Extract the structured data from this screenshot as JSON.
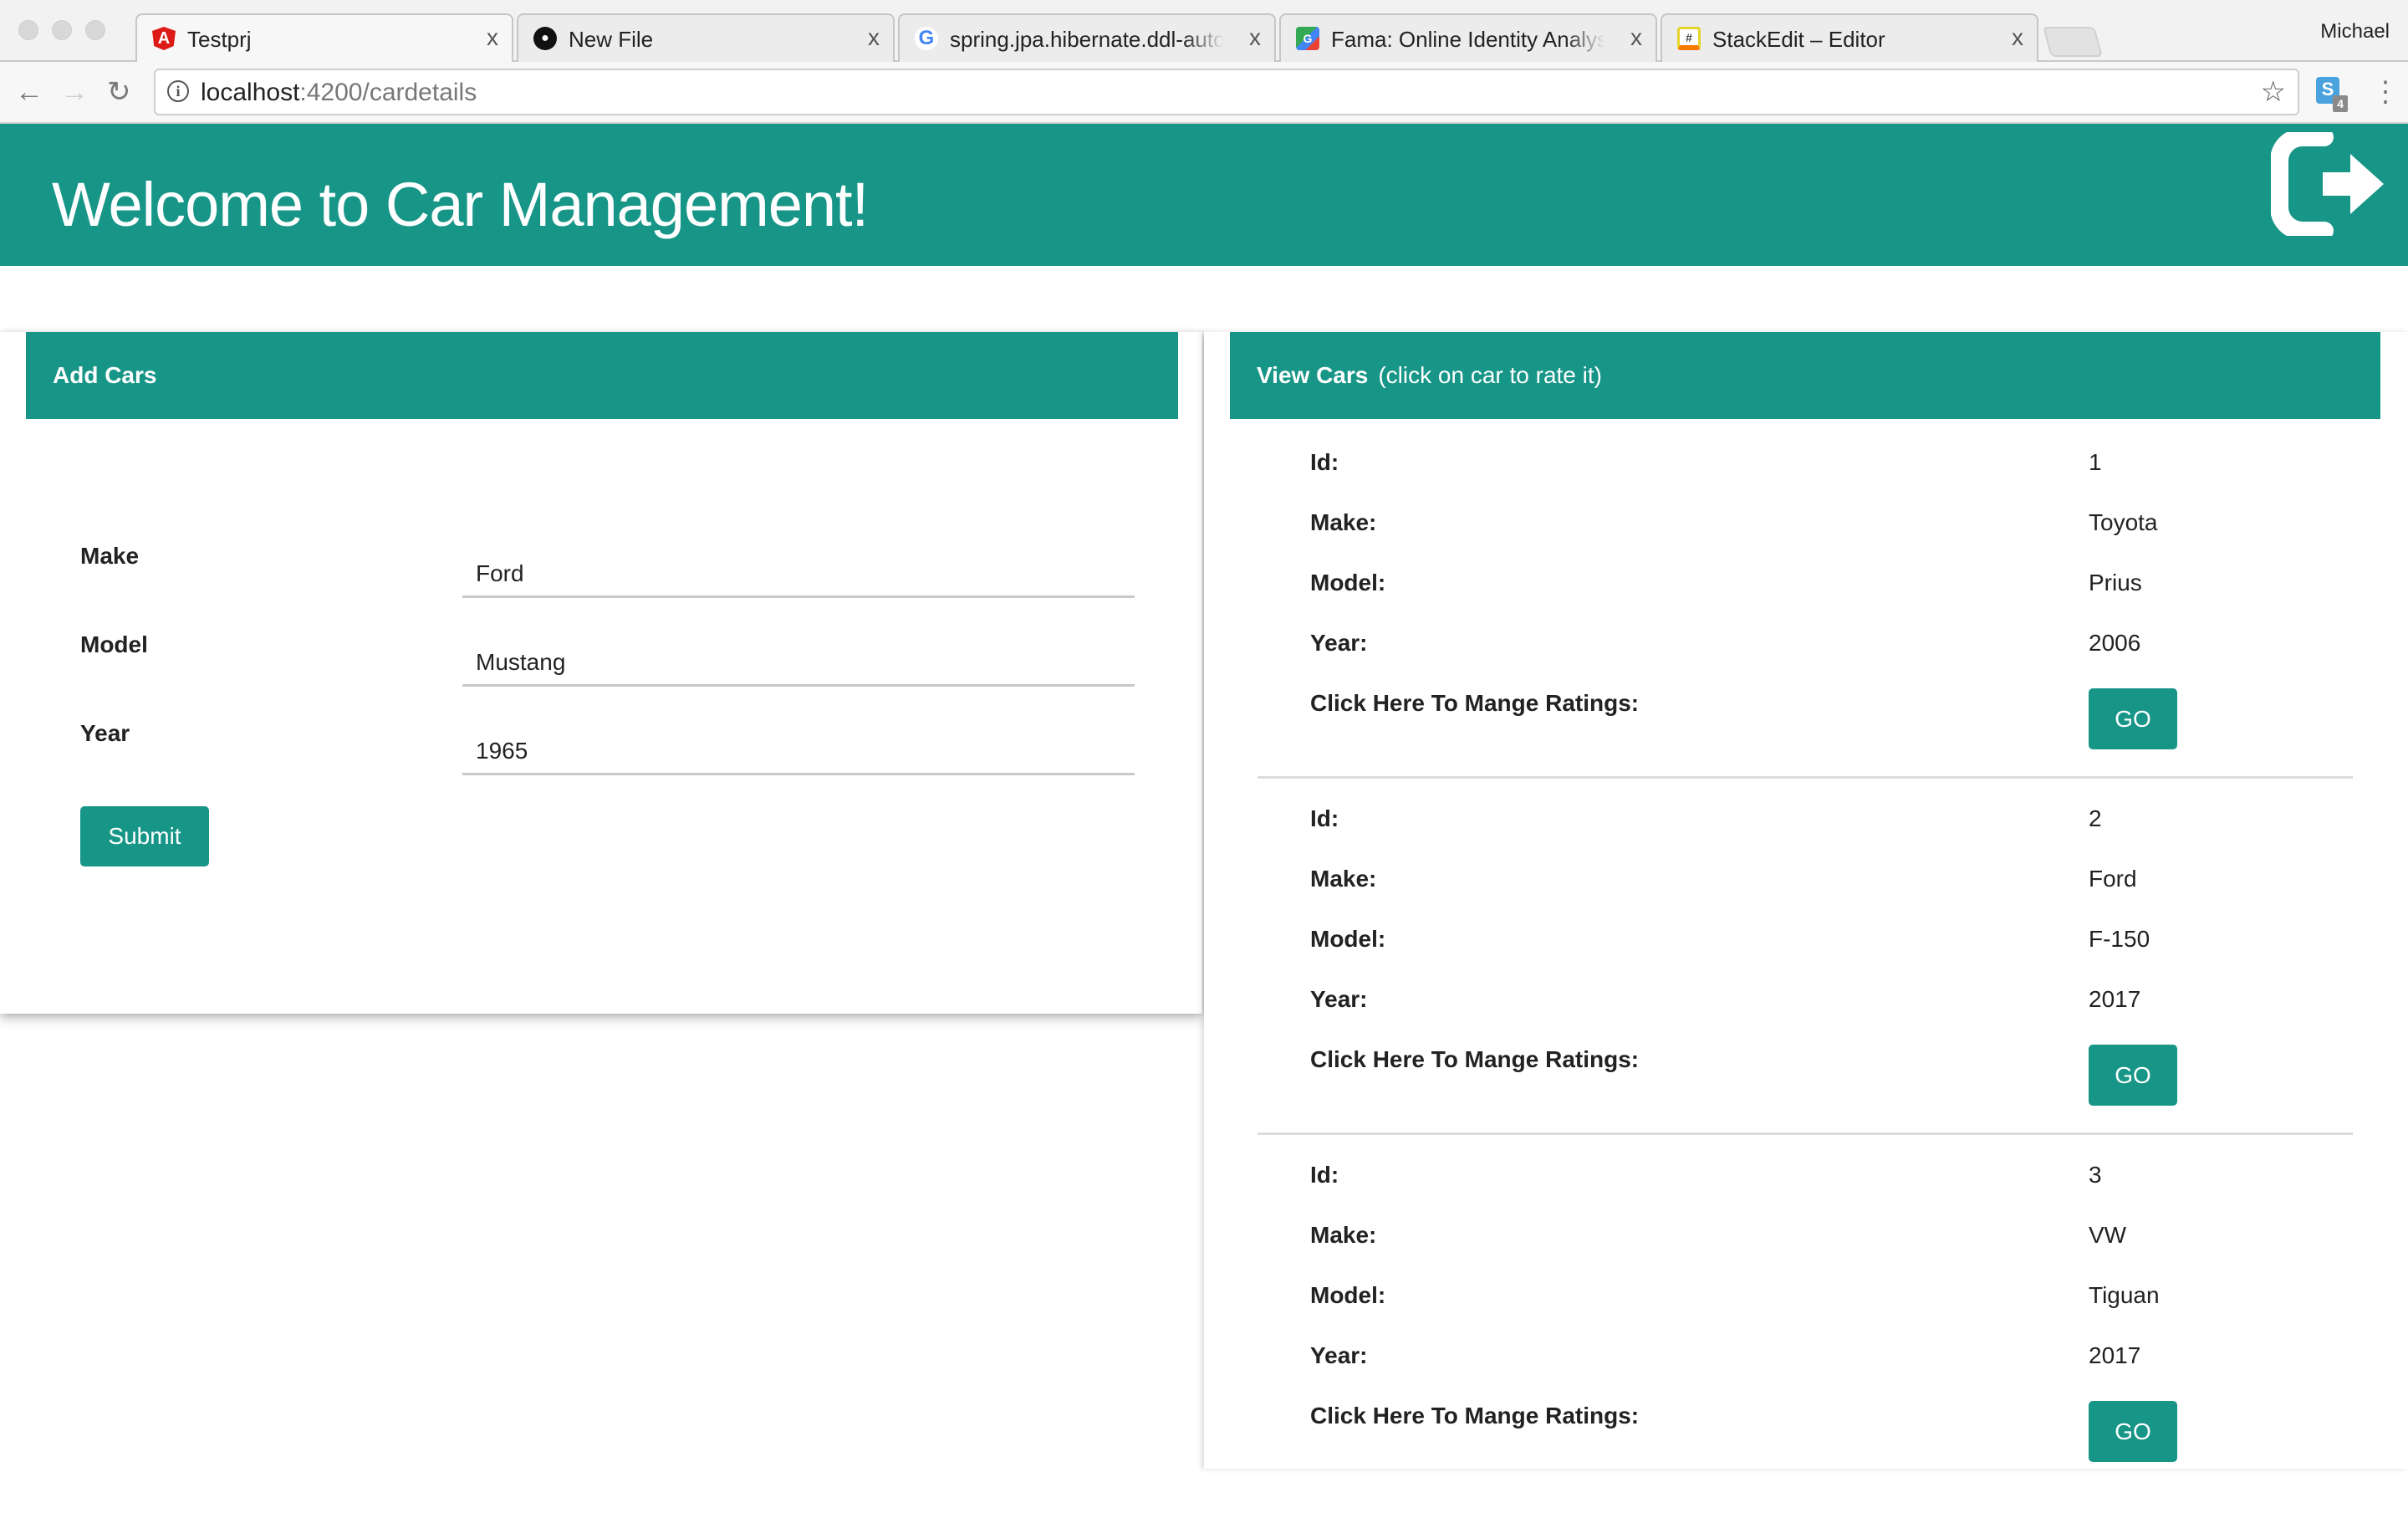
{
  "browser": {
    "tabs": [
      {
        "title": "Testprj",
        "icon": "angular-icon",
        "active": true
      },
      {
        "title": "New File",
        "icon": "github-icon",
        "active": false
      },
      {
        "title": "spring.jpa.hibernate.ddl-auto = ",
        "icon": "google-icon",
        "active": false
      },
      {
        "title": "Fama: Online Identity Analysis t",
        "icon": "google-maps-icon",
        "active": false
      },
      {
        "title": "StackEdit – Editor",
        "icon": "stackedit-icon",
        "active": false
      }
    ],
    "close_glyph": "x",
    "profile_name": "Michael",
    "url_host": "localhost",
    "url_rest": ":4200/cardetails",
    "extension_badge": "4",
    "extension_letter": "S"
  },
  "header": {
    "title": "Welcome to Car Management!",
    "accent_color": "#179688"
  },
  "add_cars": {
    "title": "Add Cars",
    "fields": [
      {
        "label": "Make",
        "value": "Ford"
      },
      {
        "label": "Model",
        "value": "Mustang"
      },
      {
        "label": "Year",
        "value": "1965"
      }
    ],
    "submit_label": "Submit"
  },
  "view_cars": {
    "title": "View Cars",
    "subtitle": "(click on car to rate it)",
    "labels": {
      "id": "Id:",
      "make": "Make:",
      "model": "Model:",
      "year": "Year:",
      "ratings": "Click Here To Mange Ratings:"
    },
    "go_label": "GO",
    "cars": [
      {
        "id": "1",
        "make": "Toyota",
        "model": "Prius",
        "year": "2006"
      },
      {
        "id": "2",
        "make": "Ford",
        "model": "F-150",
        "year": "2017"
      },
      {
        "id": "3",
        "make": "VW",
        "model": "Tiguan",
        "year": "2017"
      }
    ]
  }
}
